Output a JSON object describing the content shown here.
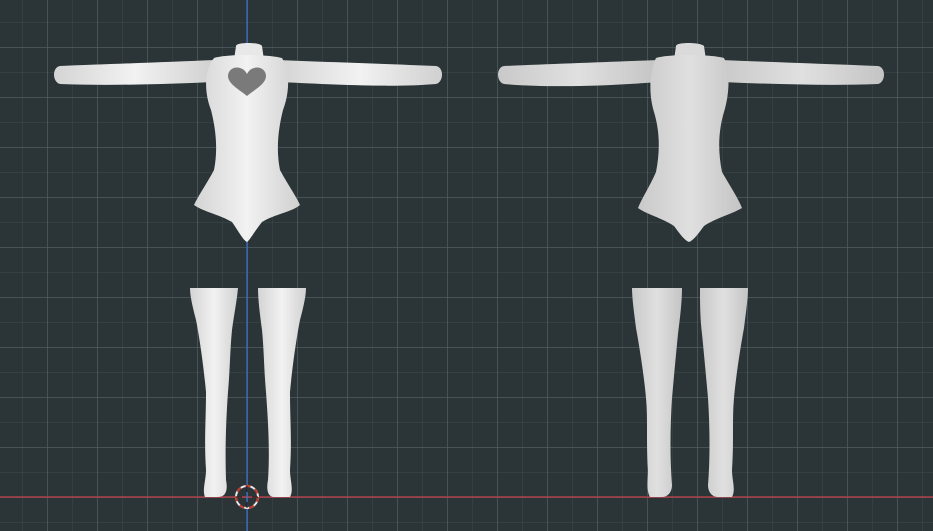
{
  "viewport": {
    "name": "3D viewport",
    "axis_x_color": "#b0404a",
    "axis_z_color": "#3d6fd1",
    "grid_color": "#4f5e60",
    "background_color": "#2b3436",
    "model_color": "#e6e6e6",
    "heart_color": "#7a7a7a"
  },
  "objects": [
    {
      "name": "bodysuit-front-view",
      "view": "front"
    },
    {
      "name": "legs-front-view",
      "view": "front"
    },
    {
      "name": "bodysuit-back-view",
      "view": "back"
    },
    {
      "name": "legs-back-view",
      "view": "back"
    }
  ],
  "cursor": {
    "icon": "3d-cursor-icon"
  }
}
